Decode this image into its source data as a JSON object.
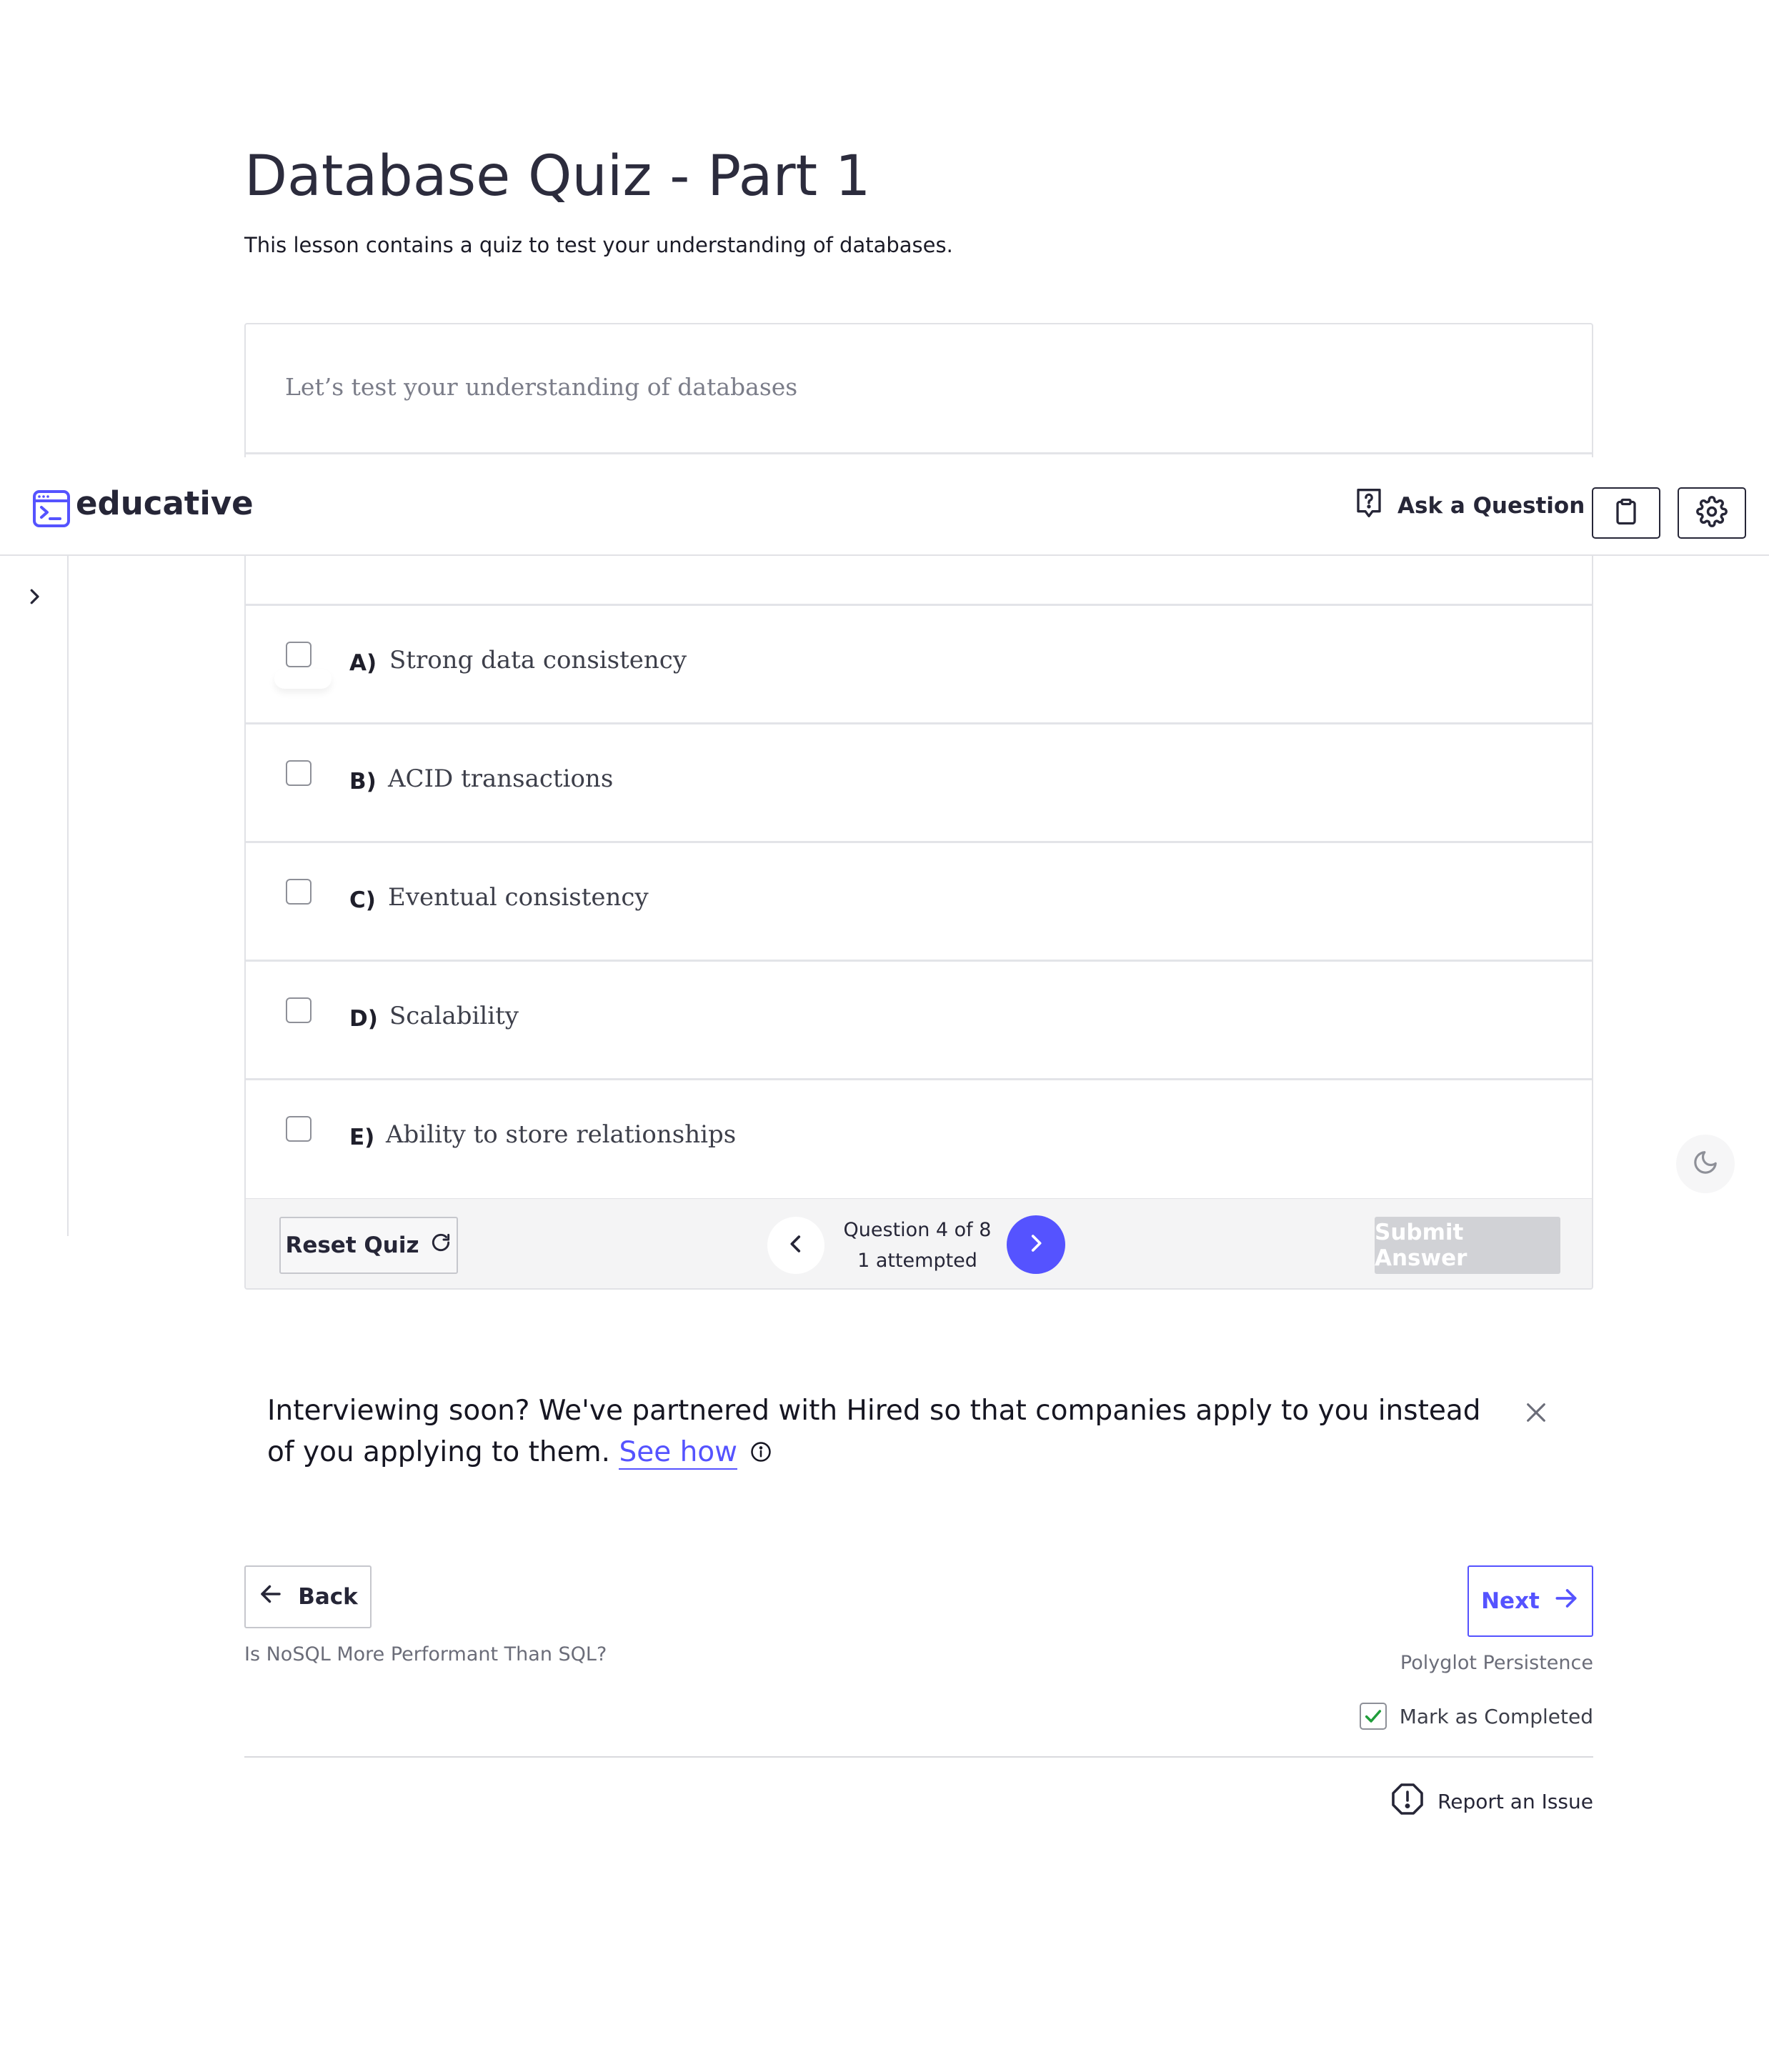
{
  "lesson": {
    "title": "Database Quiz - Part 1",
    "subtitle": "This lesson contains a quiz to test your understanding of databases."
  },
  "header": {
    "brand": "educative",
    "ask_question_label": "Ask a Question",
    "icons": {
      "logo": "educative-logo-icon",
      "ask": "question-bubble-icon",
      "clipboard": "clipboard-icon",
      "settings": "gear-icon"
    }
  },
  "quiz": {
    "intro": "Let’s test your understanding of databases",
    "options": [
      {
        "letter": "A)",
        "text": "Strong data consistency",
        "checked": false
      },
      {
        "letter": "B)",
        "text": "ACID transactions",
        "checked": false
      },
      {
        "letter": "C)",
        "text": "Eventual consistency",
        "checked": false
      },
      {
        "letter": "D)",
        "text": "Scalability",
        "checked": false
      },
      {
        "letter": "E)",
        "text": "Ability to store relationships",
        "checked": false
      }
    ],
    "footer": {
      "reset_label": "Reset Quiz",
      "question_counter": "Question 4 of 8",
      "attempted": "1 attempted",
      "submit_label": "Submit Answer"
    }
  },
  "promo": {
    "text": "Interviewing soon? We've partnered with Hired so that companies apply to you instead of you applying to them.",
    "link_label": "See how"
  },
  "navigation": {
    "back_label": "Back",
    "back_caption": "Is NoSQL More Performant Than SQL?",
    "next_label": "Next",
    "next_caption": "Polyglot Persistence",
    "mark_completed_label": "Mark as Completed",
    "mark_completed_checked": true,
    "report_issue_label": "Report an Issue"
  },
  "colors": {
    "accent": "#5553ff",
    "submit_disabled": "#d1d2d6",
    "check_green": "#1f9d3a"
  }
}
